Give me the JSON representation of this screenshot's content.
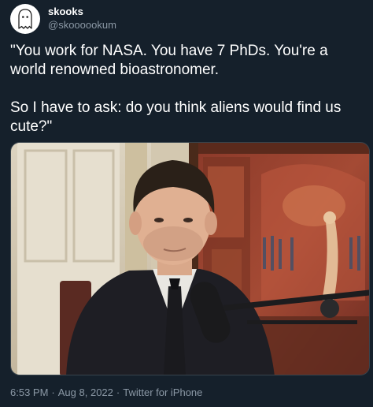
{
  "author": {
    "display_name": "skooks",
    "handle": "@skoooookum",
    "avatar_icon": "ghost-icon"
  },
  "tweet": {
    "paragraph_1": "\"You work for NASA. You have 7 PhDs. You're a world renowned bioastronomer.",
    "paragraph_2": "So I have to ask: do you think aliens would find us cute?\""
  },
  "media": {
    "type": "photo"
  },
  "meta": {
    "time": "6:53 PM",
    "separator": "·",
    "date": "Aug 8, 2022",
    "source": "Twitter for iPhone"
  },
  "colors": {
    "background": "#15202b",
    "text_primary": "#ffffff",
    "text_secondary": "#8b98a5"
  }
}
